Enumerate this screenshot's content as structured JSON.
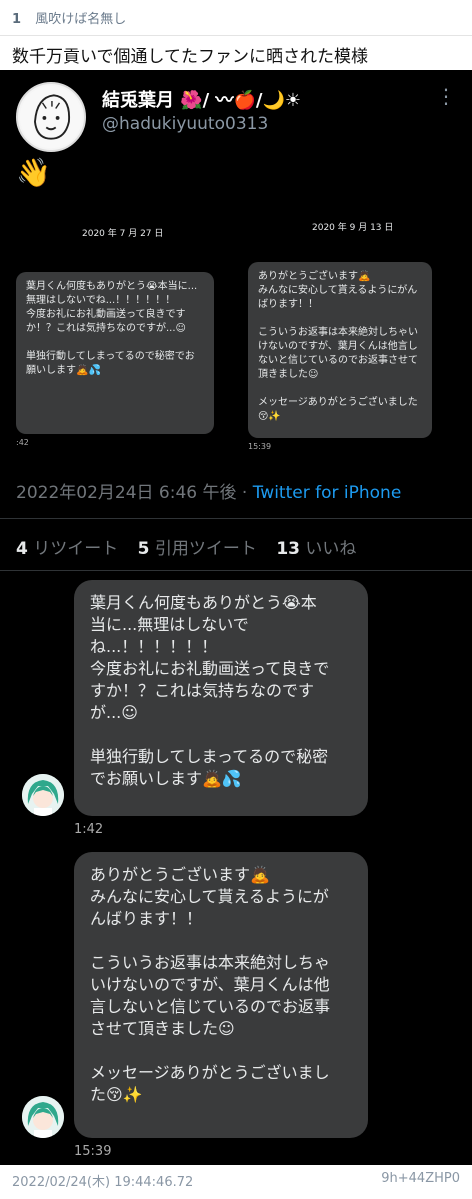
{
  "post": {
    "number": "1",
    "name": "風吹けば名無し",
    "title": "数千万貢いで個通してたファンに晒された模様",
    "datetime": "2022/02/24(木) 19:44:46.72",
    "id": "9h+44ZHP0"
  },
  "tweet": {
    "display_name": "結兎葉月 🌺/ 〰🍎/🌙☀",
    "handle": "@hadukiyuuto0313",
    "wave": "👋",
    "timestamp": "2022年02月24日 6:46 午後 · ",
    "source": "Twitter for iPhone",
    "retweets_count": "4",
    "retweets_label": "リツイート",
    "quotes_count": "5",
    "quotes_label": "引用ツイート",
    "likes_count": "13",
    "likes_label": "いいね"
  },
  "mini_dm": {
    "left_date": "2020 年 7 月 27 日",
    "left_text": "葉月くん何度もありがとう😭本当に...無理はしないでね...！！！！！！\n今度お礼にお礼動画送って良きですか！？これは気持ちなのですが...☺\n\n単独行動してしまってるので秘密でお願いします🙇💦",
    "left_time": ":42",
    "right_date": "2020 年 9 月 13 日",
    "right_text": "ありがとうございます🙇\nみんなに安心して貰えるようにがんばります！！\n\nこういうお返事は本来絶対しちゃいけないのですが、葉月くんは他言しないと信じているのでお返事させて頂きました☺\n\nメッセージありがとうございました😚✨",
    "right_time": "15:39"
  },
  "dm": [
    {
      "text": "葉月くん何度もありがとう😭本\n当に...無理はしないで\nね...！！！！！！\n今度お礼にお礼動画送って良きで\nすか！？これは気持ちなのです\nが...☺\n\n単独行動してしまってるので秘密\nでお願いします🙇💦",
      "time": "1:42"
    },
    {
      "text": "ありがとうございます🙇\nみんなに安心して貰えるようにが\nんばります！！\n\nこういうお返事は本来絶対しちゃ\nいけないのですが、葉月くんは他\n言しないと信じているのでお返事\nさせて頂きました☺\n\nメッセージありがとうございまし\nた😚✨",
      "time": "15:39"
    }
  ]
}
